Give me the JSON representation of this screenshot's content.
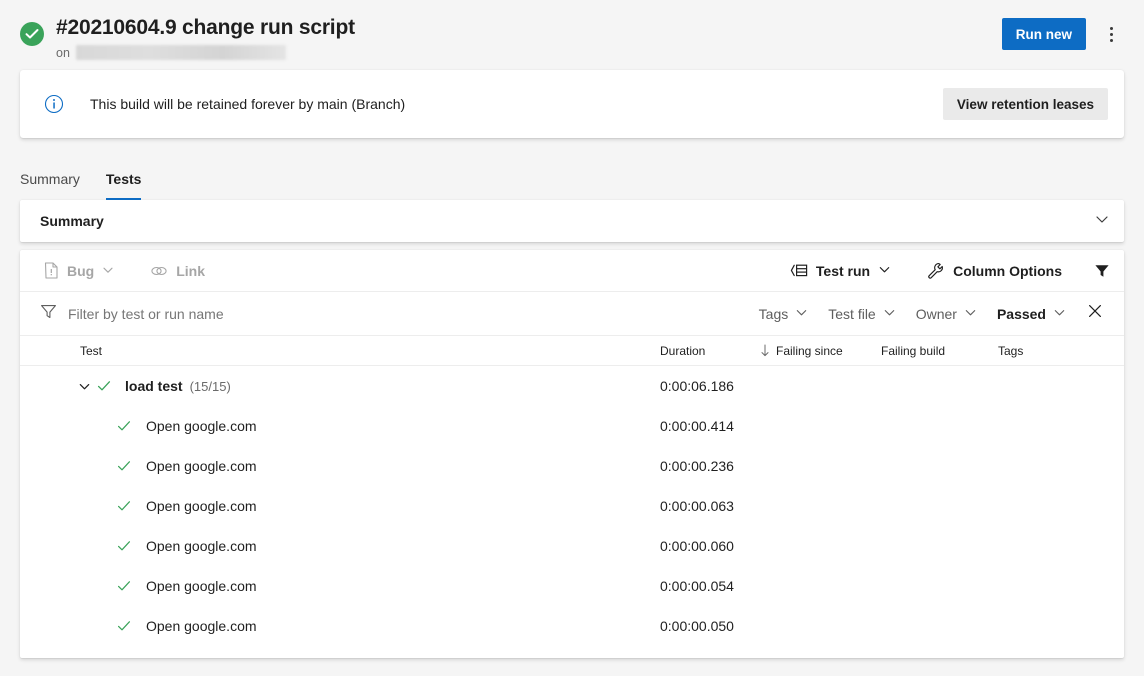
{
  "header": {
    "status_icon": "check-circle-icon",
    "status_color": "#3aa35a",
    "title": "#20210604.9 change run script",
    "on_label": "on",
    "redacted_branch": "",
    "run_new_label": "Run new",
    "more_actions_icon": "kebab-menu-icon",
    "primary_color": "#0d6cc4"
  },
  "banner": {
    "icon": "info-icon",
    "icon_color": "#0d6cc4",
    "message": "This build will be retained forever by main (Branch)",
    "action_label": "View retention leases"
  },
  "tabs": [
    {
      "label": "Summary",
      "active": false
    },
    {
      "label": "Tests",
      "active": true
    }
  ],
  "summary_section": {
    "title": "Summary",
    "chevron_icon": "chevron-down-icon"
  },
  "toolbar": {
    "bug_label": "Bug",
    "bug_icon": "bug-file-icon",
    "link_label": "Link",
    "link_icon": "link-icon",
    "test_run_label": "Test run",
    "test_run_icon": "group-by-icon",
    "column_options_label": "Column Options",
    "column_options_icon": "wrench-icon",
    "filter_icon": "funnel-filled-icon"
  },
  "filterbar": {
    "filter_icon": "funnel-outline-icon",
    "placeholder": "Filter by test or run name",
    "value": "",
    "dropdowns": [
      {
        "label": "Tags",
        "active": false
      },
      {
        "label": "Test file",
        "active": false
      },
      {
        "label": "Owner",
        "active": false
      },
      {
        "label": "Passed",
        "active": true
      }
    ],
    "close_icon": "close-icon"
  },
  "table": {
    "columns": {
      "test": "Test",
      "duration": "Duration",
      "sort_icon": "sort-descending-arrow",
      "failing_since": "Failing since",
      "failing_build": "Failing build",
      "tags": "Tags"
    },
    "group": {
      "expanded": true,
      "chevron_icon": "chevron-down-icon",
      "status_icon": "check-icon",
      "name": "load test",
      "count": "(15/15)",
      "duration": "0:00:06.186",
      "failing_since": "",
      "failing_build": "",
      "tags": ""
    },
    "rows": [
      {
        "status_icon": "check-icon",
        "name": "Open google.com",
        "duration": "0:00:00.414",
        "failing_since": "",
        "failing_build": "",
        "tags": ""
      },
      {
        "status_icon": "check-icon",
        "name": "Open google.com",
        "duration": "0:00:00.236",
        "failing_since": "",
        "failing_build": "",
        "tags": ""
      },
      {
        "status_icon": "check-icon",
        "name": "Open google.com",
        "duration": "0:00:00.063",
        "failing_since": "",
        "failing_build": "",
        "tags": ""
      },
      {
        "status_icon": "check-icon",
        "name": "Open google.com",
        "duration": "0:00:00.060",
        "failing_since": "",
        "failing_build": "",
        "tags": ""
      },
      {
        "status_icon": "check-icon",
        "name": "Open google.com",
        "duration": "0:00:00.054",
        "failing_since": "",
        "failing_build": "",
        "tags": ""
      },
      {
        "status_icon": "check-icon",
        "name": "Open google.com",
        "duration": "0:00:00.050",
        "failing_since": "",
        "failing_build": "",
        "tags": ""
      }
    ]
  }
}
